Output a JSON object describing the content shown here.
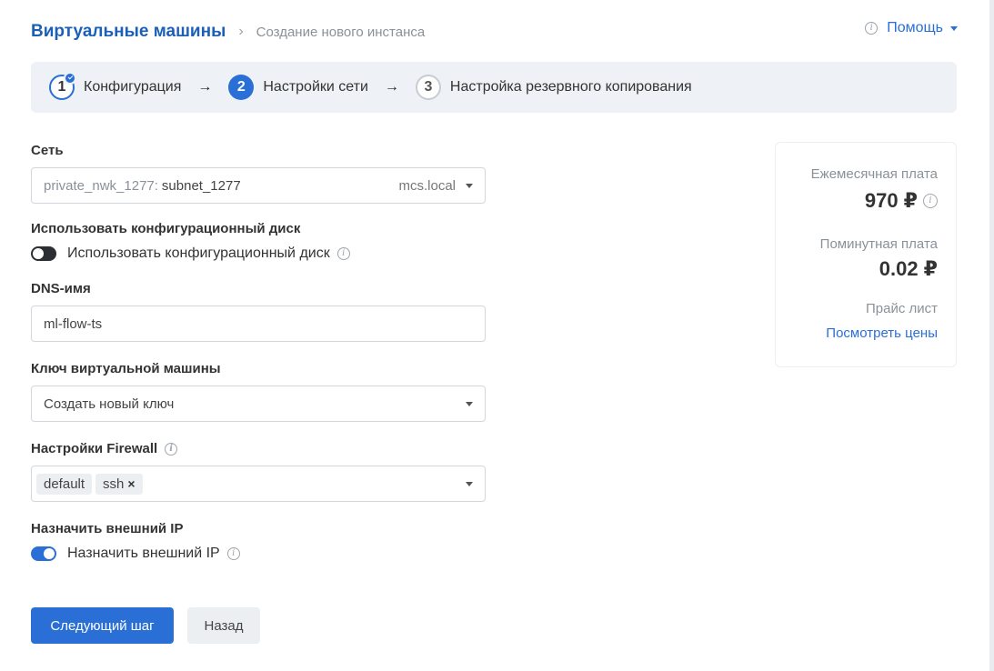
{
  "header": {
    "title": "Виртуальные машины",
    "breadcrumb_current": "Создание нового инстанса",
    "help_label": "Помощь"
  },
  "stepper": {
    "steps": [
      {
        "number": "1",
        "label": "Конфигурация",
        "state": "completed"
      },
      {
        "number": "2",
        "label": "Настройки сети",
        "state": "active"
      },
      {
        "number": "3",
        "label": "Настройка резервного копирования",
        "state": "pending"
      }
    ],
    "arrow": "→"
  },
  "form": {
    "network": {
      "label": "Сеть",
      "network_name": "private_nwk_1277:",
      "subnet_name": "subnet_1277",
      "domain": "mcs.local"
    },
    "config_disk": {
      "label": "Использовать конфигурационный диск",
      "toggle_label": "Использовать конфигурационный диск",
      "enabled": false
    },
    "dns": {
      "label": "DNS-имя",
      "value": "ml-flow-ts"
    },
    "vm_key": {
      "label": "Ключ виртуальной машины",
      "value": "Создать новый ключ"
    },
    "firewall": {
      "label": "Настройки Firewall",
      "tags": [
        {
          "label": "default",
          "removable": false
        },
        {
          "label": "ssh",
          "removable": true
        }
      ],
      "remove_glyph": "×"
    },
    "external_ip": {
      "label": "Назначить внешний IP",
      "toggle_label": "Назначить внешний IP",
      "enabled": true
    }
  },
  "buttons": {
    "next": "Следующий шаг",
    "back": "Назад"
  },
  "pricing": {
    "monthly_label": "Ежемесячная плата",
    "monthly_value": "970 ₽",
    "per_minute_label": "Поминутная плата",
    "per_minute_value": "0.02 ₽",
    "price_list_label": "Прайс лист",
    "price_list_link": "Посмотреть цены"
  },
  "icons": {
    "info": "i"
  },
  "colors": {
    "accent": "#2a6fd6",
    "title": "#1b5fb8",
    "stepper_bg": "#eef1f5"
  }
}
